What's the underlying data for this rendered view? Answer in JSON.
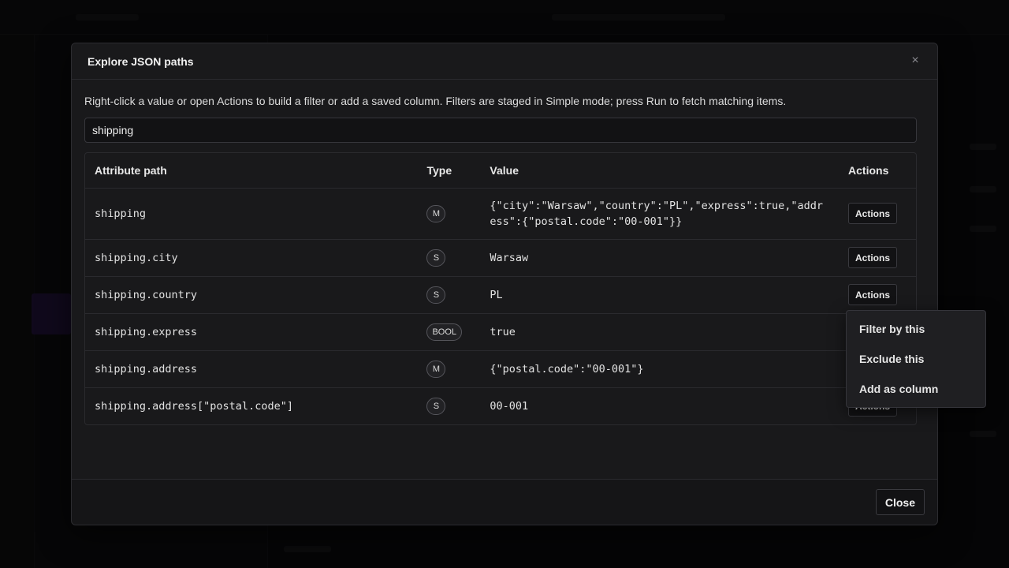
{
  "modal": {
    "title": "Explore JSON paths",
    "hint": "Right-click a value or open Actions to build a filter or add a saved column. Filters are staged in Simple mode; press Run to fetch matching items.",
    "filter_value": "shipping",
    "close_label": "Close",
    "close_icon": "×"
  },
  "table": {
    "headers": [
      "Attribute path",
      "Type",
      "Value",
      "Actions"
    ],
    "action_label": "Actions",
    "rows": [
      {
        "path": "shipping",
        "type": "M",
        "value": "{\"city\":\"Warsaw\",\"country\":\"PL\",\"express\":true,\"address\":{\"postal.code\":\"00-001\"}}"
      },
      {
        "path": "shipping.city",
        "type": "S",
        "value": "Warsaw"
      },
      {
        "path": "shipping.country",
        "type": "S",
        "value": "PL"
      },
      {
        "path": "shipping.express",
        "type": "BOOL",
        "value": "true"
      },
      {
        "path": "shipping.address",
        "type": "M",
        "value": "{\"postal.code\":\"00-001\"}"
      },
      {
        "path": "shipping.address[\"postal.code\"]",
        "type": "S",
        "value": "00-001"
      }
    ]
  },
  "context_menu": {
    "items": [
      "Filter by this",
      "Exclude this",
      "Add as column"
    ]
  }
}
